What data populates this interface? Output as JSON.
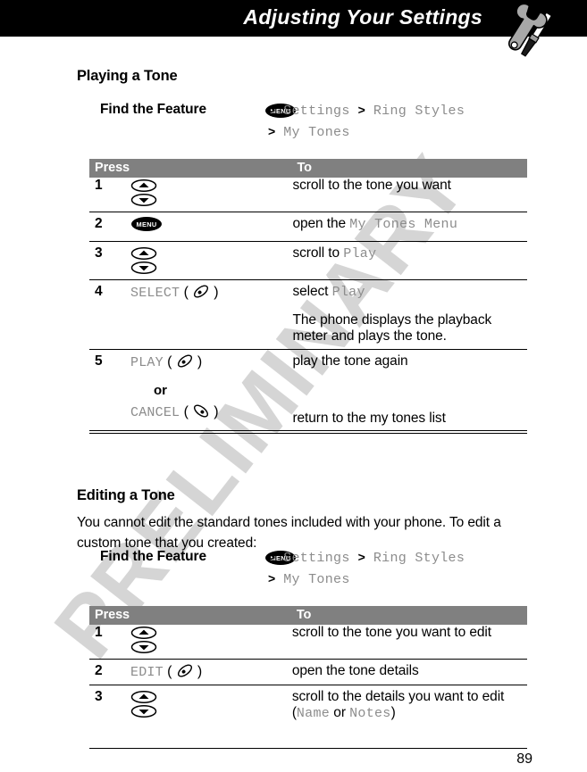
{
  "header": {
    "title": "Adjusting Your Settings",
    "icon": "wrench-screwdriver-icon",
    "band_color": "#000000"
  },
  "watermark": {
    "text": "PRELIMINARY",
    "color": "#d5d5d5"
  },
  "page_number": "89",
  "sections": [
    {
      "heading": "Playing a Tone",
      "find_the_feature": {
        "label": "Find the Feature",
        "key_icon": "menu-key-icon",
        "key_label": "MENU",
        "path_line_1_items": [
          "Settings",
          "Ring Styles"
        ],
        "path_line_2_items": [
          "My Tones"
        ],
        "separator": ">"
      },
      "table": {
        "columns": [
          "Press",
          "To"
        ],
        "rows": [
          {
            "num": "1",
            "press_icon": "nav-up-down-keys-icon",
            "press_label": "",
            "to_text": "scroll to the tone you want"
          },
          {
            "num": "2",
            "press_icon": "menu-key-icon",
            "press_label": "MENU",
            "to_text": "open the ",
            "to_mono": "My Tones Menu"
          },
          {
            "num": "3",
            "press_icon": "nav-up-down-keys-icon",
            "press_label": "",
            "to_text": "scroll to ",
            "to_mono": "Play"
          },
          {
            "num": "4",
            "press_icon": "right-soft-key-icon",
            "press_label": "SELECT",
            "to_text": "select ",
            "to_mono": "Play",
            "to_note": "The phone displays the playback meter and plays the tone."
          },
          {
            "num": "5",
            "press_icon": "right-soft-key-icon",
            "press_label": "PLAY",
            "to_text": "play the tone again",
            "or_word": "or",
            "alt_press_icon": "left-soft-key-icon",
            "alt_press_label": "CANCEL",
            "alt_to_text": "return to the my tones list"
          }
        ]
      }
    },
    {
      "heading": "Editing a Tone",
      "paragraph": "You cannot edit the standard tones included with your phone. To edit a custom tone that you created:",
      "find_the_feature": {
        "label": "Find the Feature",
        "key_icon": "menu-key-icon",
        "key_label": "MENU",
        "path_line_1_items": [
          "Settings",
          "Ring Styles"
        ],
        "path_line_2_items": [
          "My Tones"
        ],
        "separator": ">"
      },
      "table": {
        "columns": [
          "Press",
          "To"
        ],
        "rows": [
          {
            "num": "1",
            "press_icon": "nav-up-down-keys-icon",
            "press_label": "",
            "to_text": "scroll to the tone you want to edit"
          },
          {
            "num": "2",
            "press_icon": "right-soft-key-icon",
            "press_label": "EDIT",
            "to_text": "open the tone details"
          },
          {
            "num": "3",
            "press_icon": "nav-up-down-keys-icon",
            "press_label": "",
            "to_text": "scroll to the details you want to edit",
            "to_paren_prefix": "(",
            "to_paren_mono_1": "Name",
            "to_paren_mid": " or ",
            "to_paren_mono_2": "Notes",
            "to_paren_suffix": ")"
          }
        ]
      }
    }
  ]
}
